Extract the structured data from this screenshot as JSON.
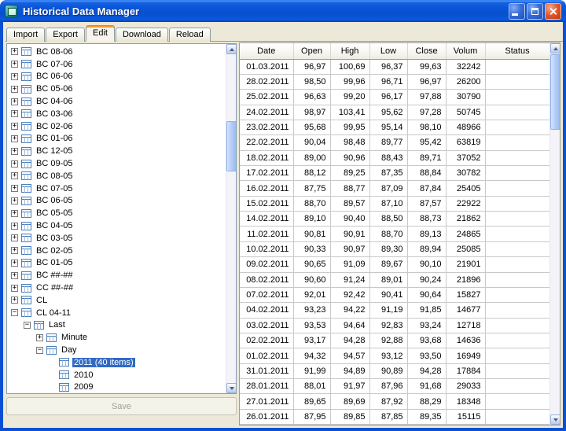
{
  "window": {
    "title": "Historical Data Manager"
  },
  "colors": {
    "titlebar": "#0a55d8",
    "selection": "#316AC5",
    "window_face": "#ECE9D8",
    "disabled_text": "#a0a099",
    "tab_accent": "#f09a38"
  },
  "tabs": [
    "Import",
    "Export",
    "Edit",
    "Download",
    "Reload"
  ],
  "active_tab": "Edit",
  "tree": {
    "items": [
      {
        "label": "BC 08-06",
        "level": 0,
        "exp": "plus"
      },
      {
        "label": "BC 07-06",
        "level": 0,
        "exp": "plus"
      },
      {
        "label": "BC 06-06",
        "level": 0,
        "exp": "plus"
      },
      {
        "label": "BC 05-06",
        "level": 0,
        "exp": "plus"
      },
      {
        "label": "BC 04-06",
        "level": 0,
        "exp": "plus"
      },
      {
        "label": "BC 03-06",
        "level": 0,
        "exp": "plus"
      },
      {
        "label": "BC 02-06",
        "level": 0,
        "exp": "plus"
      },
      {
        "label": "BC 01-06",
        "level": 0,
        "exp": "plus"
      },
      {
        "label": "BC 12-05",
        "level": 0,
        "exp": "plus"
      },
      {
        "label": "BC 09-05",
        "level": 0,
        "exp": "plus"
      },
      {
        "label": "BC 08-05",
        "level": 0,
        "exp": "plus"
      },
      {
        "label": "BC 07-05",
        "level": 0,
        "exp": "plus"
      },
      {
        "label": "BC 06-05",
        "level": 0,
        "exp": "plus"
      },
      {
        "label": "BC 05-05",
        "level": 0,
        "exp": "plus"
      },
      {
        "label": "BC 04-05",
        "level": 0,
        "exp": "plus"
      },
      {
        "label": "BC 03-05",
        "level": 0,
        "exp": "plus"
      },
      {
        "label": "BC 02-05",
        "level": 0,
        "exp": "plus"
      },
      {
        "label": "BC 01-05",
        "level": 0,
        "exp": "plus"
      },
      {
        "label": "BC ##-##",
        "level": 0,
        "exp": "plus"
      },
      {
        "label": "CC ##-##",
        "level": 0,
        "exp": "plus"
      },
      {
        "label": "CL",
        "level": 0,
        "exp": "plus"
      },
      {
        "label": "CL 04-11",
        "level": 0,
        "exp": "minus"
      },
      {
        "label": "Last",
        "level": 1,
        "exp": "minus"
      },
      {
        "label": "Minute",
        "level": 2,
        "exp": "plus"
      },
      {
        "label": "Day",
        "level": 2,
        "exp": "minus"
      },
      {
        "label": "2011 (40 items)",
        "level": 3,
        "exp": "none",
        "selected": true
      },
      {
        "label": "2010",
        "level": 3,
        "exp": "none"
      },
      {
        "label": "2009",
        "level": 3,
        "exp": "none"
      }
    ]
  },
  "save_button": {
    "label": "Save",
    "disabled": true
  },
  "grid": {
    "columns": [
      "Date",
      "Open",
      "High",
      "Low",
      "Close",
      "Volum",
      "Status"
    ],
    "rows": [
      [
        "01.03.2011",
        "96,97",
        "100,69",
        "96,37",
        "99,63",
        "32242",
        ""
      ],
      [
        "28.02.2011",
        "98,50",
        "99,96",
        "96,71",
        "96,97",
        "26200",
        ""
      ],
      [
        "25.02.2011",
        "96,63",
        "99,20",
        "96,17",
        "97,88",
        "30790",
        ""
      ],
      [
        "24.02.2011",
        "98,97",
        "103,41",
        "95,62",
        "97,28",
        "50745",
        ""
      ],
      [
        "23.02.2011",
        "95,68",
        "99,95",
        "95,14",
        "98,10",
        "48966",
        ""
      ],
      [
        "22.02.2011",
        "90,04",
        "98,48",
        "89,77",
        "95,42",
        "63819",
        ""
      ],
      [
        "18.02.2011",
        "89,00",
        "90,96",
        "88,43",
        "89,71",
        "37052",
        ""
      ],
      [
        "17.02.2011",
        "88,12",
        "89,25",
        "87,35",
        "88,84",
        "30782",
        ""
      ],
      [
        "16.02.2011",
        "87,75",
        "88,77",
        "87,09",
        "87,84",
        "25405",
        ""
      ],
      [
        "15.02.2011",
        "88,70",
        "89,57",
        "87,10",
        "87,57",
        "22922",
        ""
      ],
      [
        "14.02.2011",
        "89,10",
        "90,40",
        "88,50",
        "88,73",
        "21862",
        ""
      ],
      [
        "11.02.2011",
        "90,81",
        "90,91",
        "88,70",
        "89,13",
        "24865",
        ""
      ],
      [
        "10.02.2011",
        "90,33",
        "90,97",
        "89,30",
        "89,94",
        "25085",
        ""
      ],
      [
        "09.02.2011",
        "90,65",
        "91,09",
        "89,67",
        "90,10",
        "21901",
        ""
      ],
      [
        "08.02.2011",
        "90,60",
        "91,24",
        "89,01",
        "90,24",
        "21896",
        ""
      ],
      [
        "07.02.2011",
        "92,01",
        "92,42",
        "90,41",
        "90,64",
        "15827",
        ""
      ],
      [
        "04.02.2011",
        "93,23",
        "94,22",
        "91,19",
        "91,85",
        "14677",
        ""
      ],
      [
        "03.02.2011",
        "93,53",
        "94,64",
        "92,83",
        "93,24",
        "12718",
        ""
      ],
      [
        "02.02.2011",
        "93,17",
        "94,28",
        "92,88",
        "93,68",
        "14636",
        ""
      ],
      [
        "01.02.2011",
        "94,32",
        "94,57",
        "93,12",
        "93,50",
        "16949",
        ""
      ],
      [
        "31.01.2011",
        "91,99",
        "94,89",
        "90,89",
        "94,28",
        "17884",
        ""
      ],
      [
        "28.01.2011",
        "88,01",
        "91,97",
        "87,96",
        "91,68",
        "29033",
        ""
      ],
      [
        "27.01.2011",
        "89,65",
        "89,69",
        "87,92",
        "88,29",
        "18348",
        ""
      ],
      [
        "26.01.2011",
        "87,95",
        "89,85",
        "87,85",
        "89,35",
        "15115",
        ""
      ]
    ]
  }
}
